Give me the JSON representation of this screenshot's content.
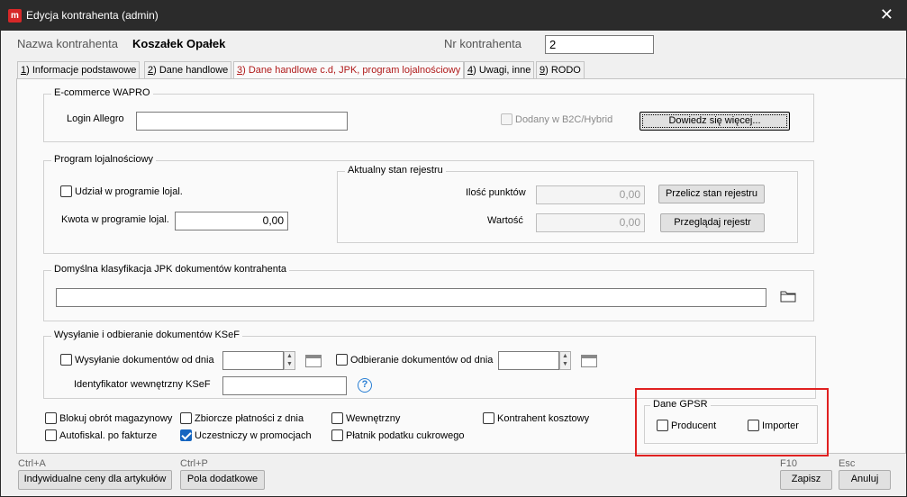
{
  "window": {
    "title": "Edycja kontrahenta (admin)",
    "app_icon_letter": "m"
  },
  "header": {
    "name_label": "Nazwa kontrahenta",
    "name_value": "Koszałek Opałek",
    "nr_label": "Nr kontrahenta",
    "nr_value": "2"
  },
  "tabs": [
    {
      "key": "1",
      "label": ") Informacje podstawowe"
    },
    {
      "key": "2",
      "label": ") Dane handlowe"
    },
    {
      "key": "3",
      "label": ") Dane handlowe c.d, JPK, program lojalnościowy"
    },
    {
      "key": "4",
      "label": ") Uwagi, inne"
    },
    {
      "key": "9",
      "label": ") RODO"
    }
  ],
  "ecommerce": {
    "title": "E-commerce WAPRO",
    "login_label": "Login  Allegro",
    "login_value": "",
    "b2c_label": "Dodany w B2C/Hybrid",
    "more_button": "Dowiedz się więcej..."
  },
  "loyalty": {
    "title": "Program lojalnościowy",
    "participate_label": "Udział w programie lojal.",
    "amount_label": "Kwota w programie lojal.",
    "amount_value": "0,00",
    "register": {
      "title": "Aktualny stan rejestru",
      "points_label": "Ilość punktów",
      "points_value": "0,00",
      "value_label": "Wartość",
      "value_value": "0,00",
      "recalc_button": "Przelicz stan rejestru",
      "browse_button": "Przeglądaj rejestr"
    }
  },
  "jpk": {
    "title": "Domyślna klasyfikacja JPK dokumentów kontrahenta",
    "value": ""
  },
  "ksef": {
    "title": "Wysyłanie i odbieranie dokumentów KSeF",
    "send_label": "Wysyłanie dokumentów od dnia",
    "receive_label": "Odbieranie dokumentów od dnia",
    "internal_id_label": "Identyfikator wewnętrzny KSeF",
    "help_symbol": "?"
  },
  "flags": {
    "block": "Blokuj obrót magazynowy",
    "collective": "Zbiorcze płatności z dnia",
    "internal": "Wewnętrzny",
    "cost": "Kontrahent kosztowy",
    "autofiscal": "Autofiskal. po fakturze",
    "promo": "Uczestniczy w promocjach",
    "sugar": "Płatnik podatku cukrowego"
  },
  "gpsr": {
    "title": "Dane GPSR",
    "producer": "Producent",
    "importer": "Importer"
  },
  "footer": {
    "shortcut_prices": "Ctrl+A",
    "prices_button": "Indywidualne ceny dla artykułów",
    "shortcut_fields": "Ctrl+P",
    "fields_button": "Pola dodatkowe",
    "shortcut_save": "F10",
    "save_button": "Zapisz",
    "shortcut_cancel": "Esc",
    "cancel_button": "Anuluj"
  },
  "colors": {
    "titlebar": "#2b2b2b",
    "active_tab": "#b01b1b",
    "highlight_box": "#e02020",
    "checkbox_checked": "#1565c0"
  }
}
